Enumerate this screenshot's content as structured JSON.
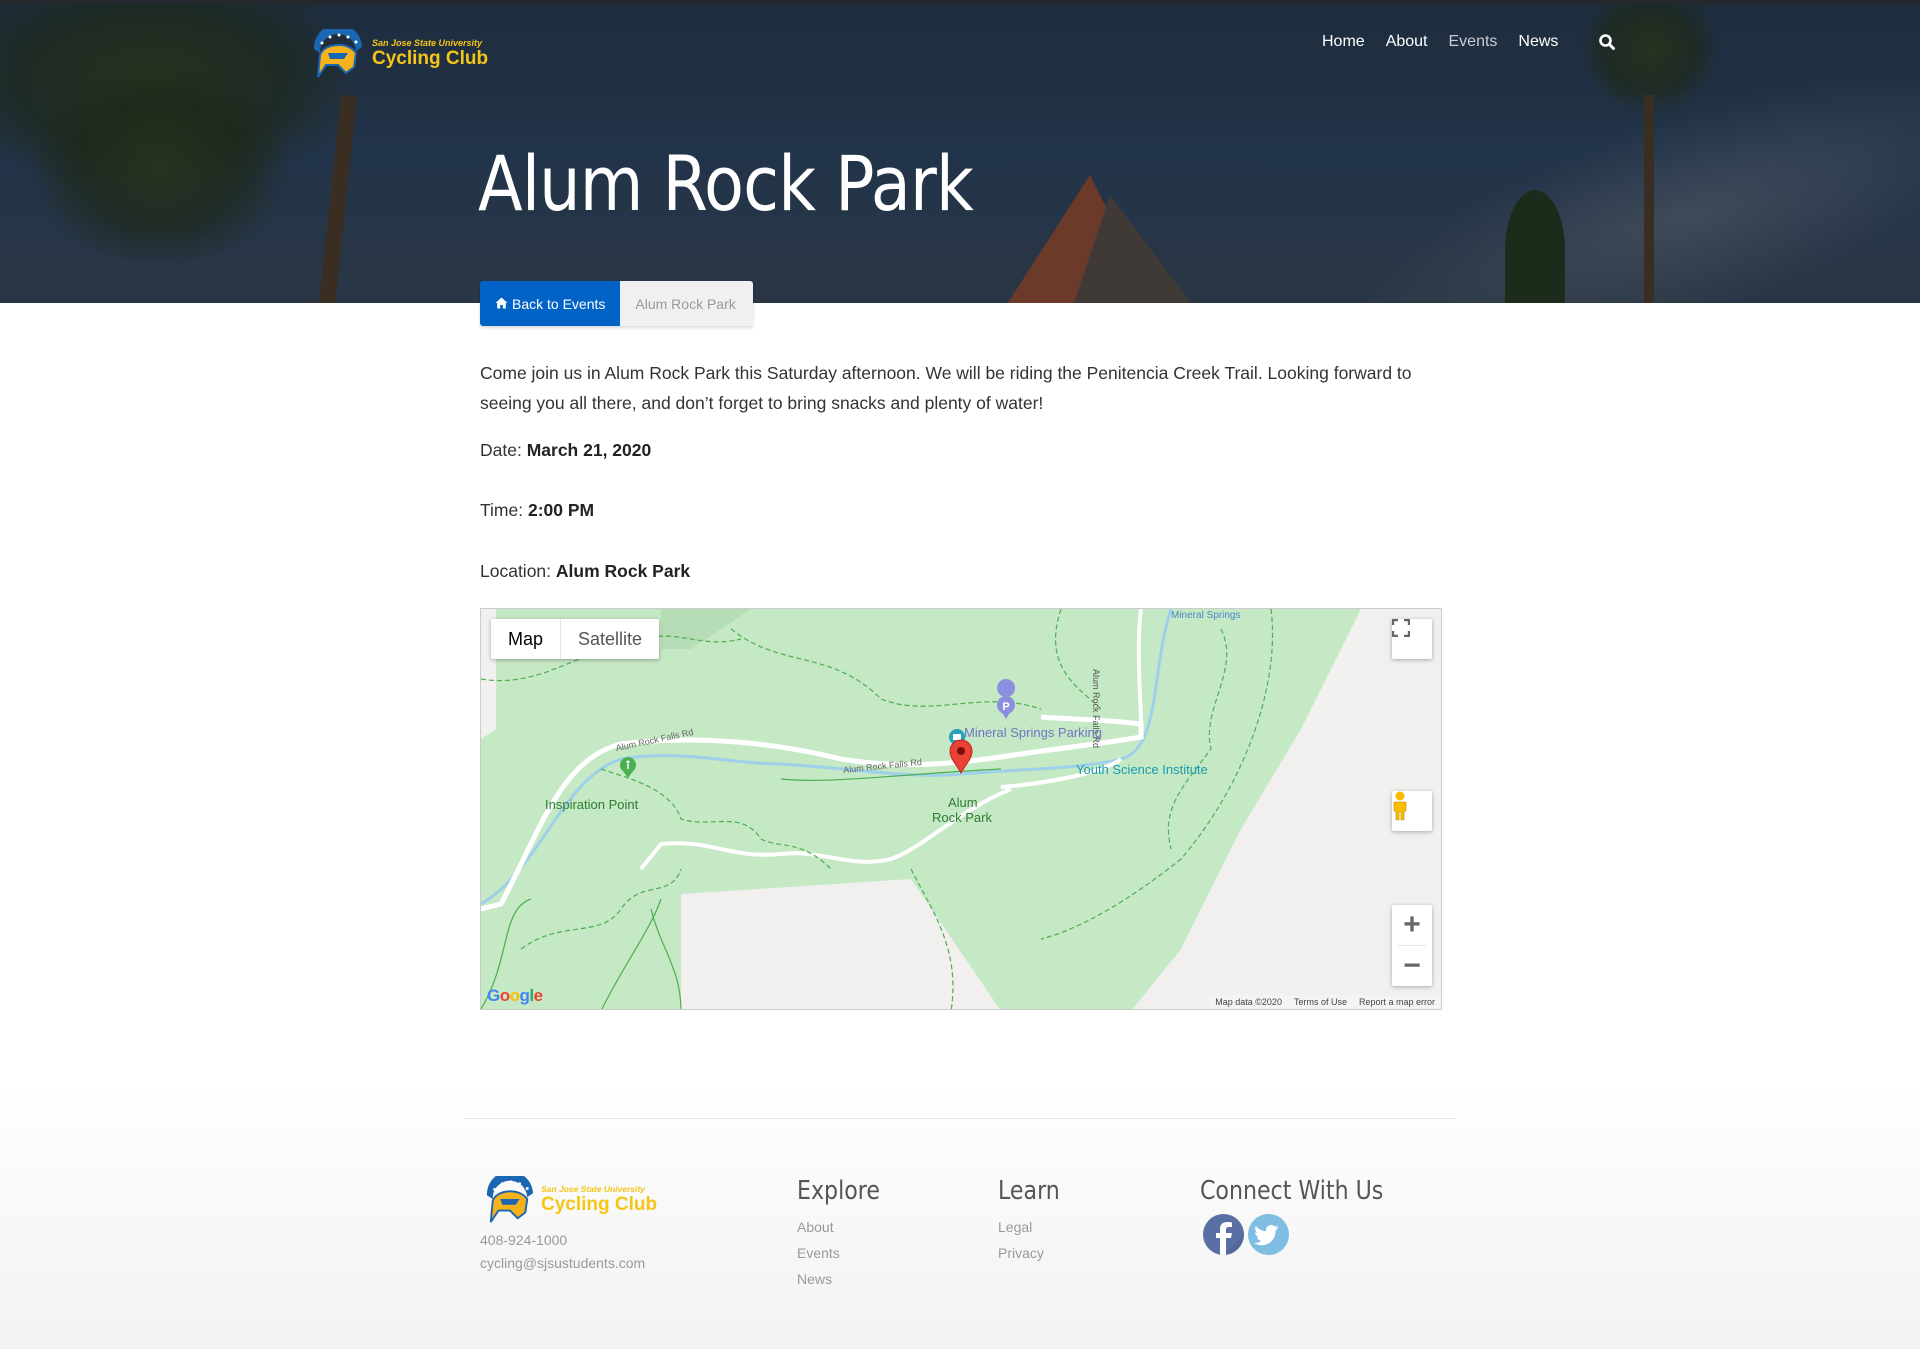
{
  "brand": {
    "line1": "San Jose State University",
    "line2": "Cycling Club",
    "color": "#f5c518"
  },
  "nav": {
    "items": [
      {
        "label": "Home",
        "active": false
      },
      {
        "label": "About",
        "active": false
      },
      {
        "label": "Events",
        "active": true
      },
      {
        "label": "News",
        "active": false
      }
    ],
    "search_icon": "search-icon"
  },
  "page": {
    "title": "Alum Rock Park"
  },
  "breadcrumb": {
    "back_label": "Back to Events",
    "back_icon": "home-icon",
    "current": "Alum Rock Park",
    "accent": "#0263c6"
  },
  "event": {
    "description": "Come join us in Alum Rock Park this Saturday afternoon. We will be riding the Penitencia Creek Trail. Looking forward to seeing you all there, and don’t forget to bring snacks and plenty of water!",
    "date_label": "Date:",
    "date_value": "March 21, 2020",
    "time_label": "Time:",
    "time_value": "2:00 PM",
    "location_label": "Location:",
    "location_value": "Alum Rock Park"
  },
  "map": {
    "type_options": [
      "Map",
      "Satellite"
    ],
    "selected_type": "Map",
    "labels": {
      "road1": "Alum Rock Falls Rd",
      "road2": "Alum Rock Falls Rd",
      "road3": "Alum Rock Falls Rd",
      "mineral_springs": "Mineral Springs",
      "parking": "Mineral Springs Parking",
      "youth": "Youth Science Institute",
      "inspiration": "Inspiration Point",
      "marker_line1": "Alum",
      "marker_line2": "Rock Park"
    },
    "zoom_in": "+",
    "zoom_out": "−",
    "google": "Google",
    "attribution": [
      "Map data ©2020",
      "Terms of Use",
      "Report a map error"
    ]
  },
  "footer": {
    "phone": "408-924-1000",
    "email": "cycling@sjsustudents.com",
    "explore": {
      "title": "Explore",
      "links": [
        "About",
        "Events",
        "News"
      ]
    },
    "learn": {
      "title": "Learn",
      "links": [
        "Legal",
        "Privacy"
      ]
    },
    "connect": {
      "title": "Connect With Us",
      "social": [
        "facebook",
        "twitter"
      ]
    }
  }
}
